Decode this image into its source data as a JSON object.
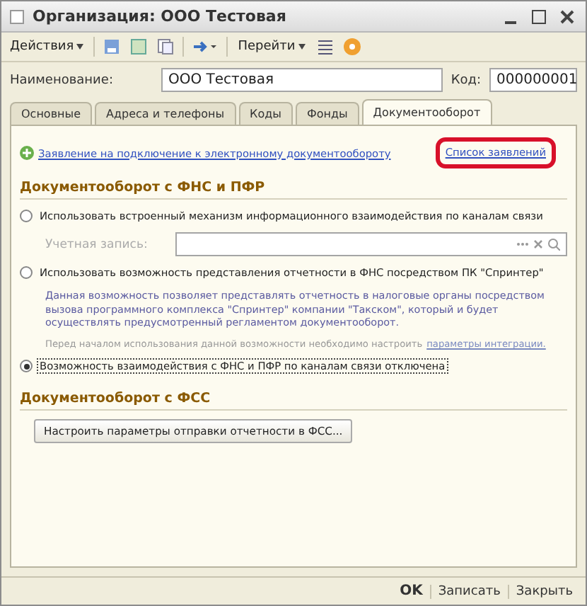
{
  "window": {
    "title": "Организация: ООО Тестовая"
  },
  "toolbar": {
    "actions": "Действия",
    "goto": "Перейти"
  },
  "name_field": {
    "label": "Наименование:",
    "value": "ООО Тестовая"
  },
  "code_field": {
    "label": "Код:",
    "value": "000000001"
  },
  "tabs": [
    {
      "label": "Основные",
      "selected": false
    },
    {
      "label": "Адреса и телефоны",
      "selected": false
    },
    {
      "label": "Коды",
      "selected": false
    },
    {
      "label": "Фонды",
      "selected": false
    },
    {
      "label": "Документооборот",
      "selected": true
    }
  ],
  "application_link": "Заявление на подключение к электронному документообороту",
  "applications_list_link": "Список заявлений",
  "section_fns": {
    "title": "Документооборот с ФНС и ПФР"
  },
  "options": [
    {
      "label": "Использовать встроенный механизм информационного взаимодействия по каналам связи",
      "selected": false,
      "kind": "account"
    },
    {
      "label": "Использовать возможность представления отчетности в ФНС посредством ПК \"Спринтер\"",
      "selected": false,
      "kind": "sprinter"
    },
    {
      "label": "Возможность взаимодействия с ФНС и ПФР по каналам связи отключена",
      "selected": true,
      "kind": "plain"
    }
  ],
  "account_field": {
    "label": "Учетная запись:"
  },
  "sprinter_description": "Данная возможность позволяет представлять отчетность в налоговые органы посредством вызова программного комплекса \"Спринтер\" компании \"Такском\", который и будет осуществлять предусмотренный регламентом документооборот.",
  "sprinter_note": "Перед началом использования данной возможности необходимо настроить",
  "sprinter_note_link": "параметры интеграции.",
  "section_fss": {
    "title": "Документооборот с ФСС"
  },
  "fss_button": "Настроить параметры отправки отчетности в ФСС...",
  "footer_buttons": [
    {
      "label": "OK",
      "kind": "primary"
    },
    {
      "label": "Записать",
      "kind": "normal"
    },
    {
      "label": "Закрыть",
      "kind": "normal"
    }
  ]
}
